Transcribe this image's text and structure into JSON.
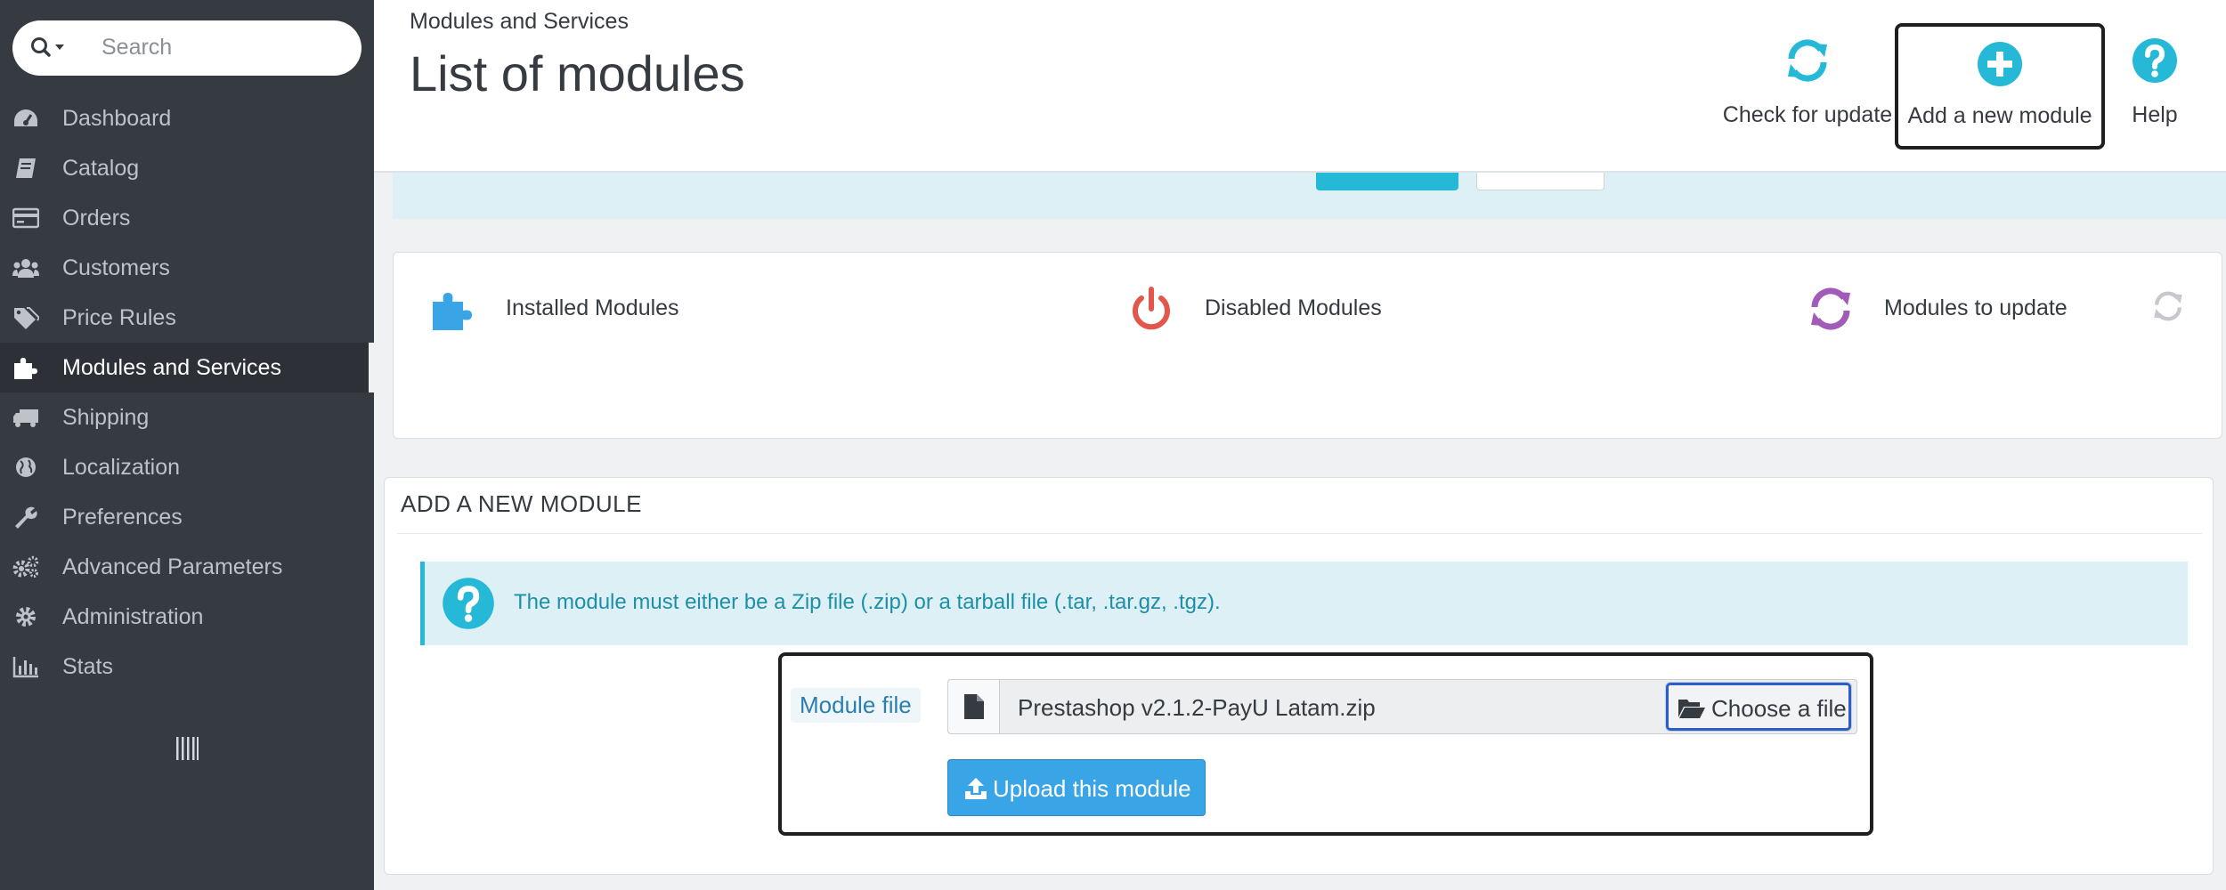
{
  "search": {
    "placeholder": "Search"
  },
  "sidebar": {
    "items": [
      {
        "label": "Dashboard",
        "icon": "dashboard-icon"
      },
      {
        "label": "Catalog",
        "icon": "book-icon"
      },
      {
        "label": "Orders",
        "icon": "credit-card-icon"
      },
      {
        "label": "Customers",
        "icon": "users-icon"
      },
      {
        "label": "Price Rules",
        "icon": "tags-icon"
      },
      {
        "label": "Modules and Services",
        "icon": "puzzle-icon",
        "active": true
      },
      {
        "label": "Shipping",
        "icon": "truck-icon"
      },
      {
        "label": "Localization",
        "icon": "globe-icon"
      },
      {
        "label": "Preferences",
        "icon": "wrench-icon"
      },
      {
        "label": "Advanced Parameters",
        "icon": "cogs-icon"
      },
      {
        "label": "Administration",
        "icon": "gear-icon"
      },
      {
        "label": "Stats",
        "icon": "bar-chart-icon"
      }
    ]
  },
  "header": {
    "breadcrumb": "Modules and Services",
    "title": "List of modules",
    "toolbar": {
      "check_update": "Check for update",
      "add_module": "Add a new module",
      "help": "Help"
    }
  },
  "stats": {
    "installed": "Installed Modules",
    "disabled": "Disabled Modules",
    "to_update": "Modules to update"
  },
  "add_module": {
    "heading": "ADD A NEW MODULE",
    "info": "The module must either be a Zip file (.zip) or a tarball file (.tar, .tar.gz, .tgz).",
    "file_label": "Module file",
    "file_name": "Prestashop v2.1.2-PayU Latam.zip",
    "choose_label": "Choose a file",
    "upload_label": "Upload this module"
  },
  "colors": {
    "sidebar_bg": "#363a41",
    "accent_cyan": "#25b9d7",
    "upload_blue": "#3aa5e6",
    "disabled_red": "#e2574c",
    "update_purple": "#a05cb8"
  }
}
